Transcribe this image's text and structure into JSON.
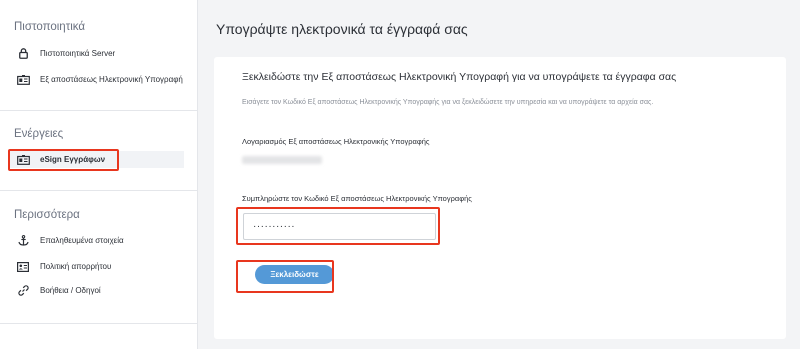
{
  "sidebar": {
    "sections": [
      {
        "title": "Πιστοποιητικά",
        "items": [
          {
            "label": "Πιστοποιητικά Server",
            "icon": "lock-icon"
          },
          {
            "label": "Εξ αποστάσεως Ηλεκτρονική Υπογραφή",
            "icon": "id-card-icon"
          }
        ]
      },
      {
        "title": "Ενέργειες",
        "items": [
          {
            "label": "eSign Εγγράφων",
            "icon": "id-card-icon",
            "active": true
          }
        ]
      },
      {
        "title": "Περισσότερα",
        "items": [
          {
            "label": "Επαληθευμένα στοιχεία",
            "icon": "anchor-icon"
          },
          {
            "label": "Πολιτική απορρήτου",
            "icon": "address-card-icon"
          },
          {
            "label": "Βοήθεια / Οδηγοί",
            "icon": "link-icon"
          }
        ]
      }
    ]
  },
  "main": {
    "title": "Υπογράψτε ηλεκτρονικά τα έγγραφά σας",
    "card": {
      "title": "Ξεκλειδώστε την Εξ αποστάσεως Ηλεκτρονική Υπογραφή για να υπογράψετε τα έγγραφα σας",
      "description": "Εισάγετε τον Κωδικό Εξ αποστάσεως Ηλεκτρονικής Υπογραφής για να ξεκλειδώσετε την υπηρεσία και να υπογράψετε τα αρχεία σας.",
      "account_label": "Λογαριασμός Εξ αποστάσεως Ηλεκτρονικής Υπογραφής",
      "password_label": "Συμπληρώστε τον Κωδικό Εξ αποστάσεως Ηλεκτρονικής Υπογραφής",
      "password_value": "···········",
      "unlock_button": "Ξεκλειδώστε"
    }
  },
  "colors": {
    "accent_button": "#5499d7",
    "highlight_box": "#e8361e",
    "background": "#f3f4f6"
  }
}
